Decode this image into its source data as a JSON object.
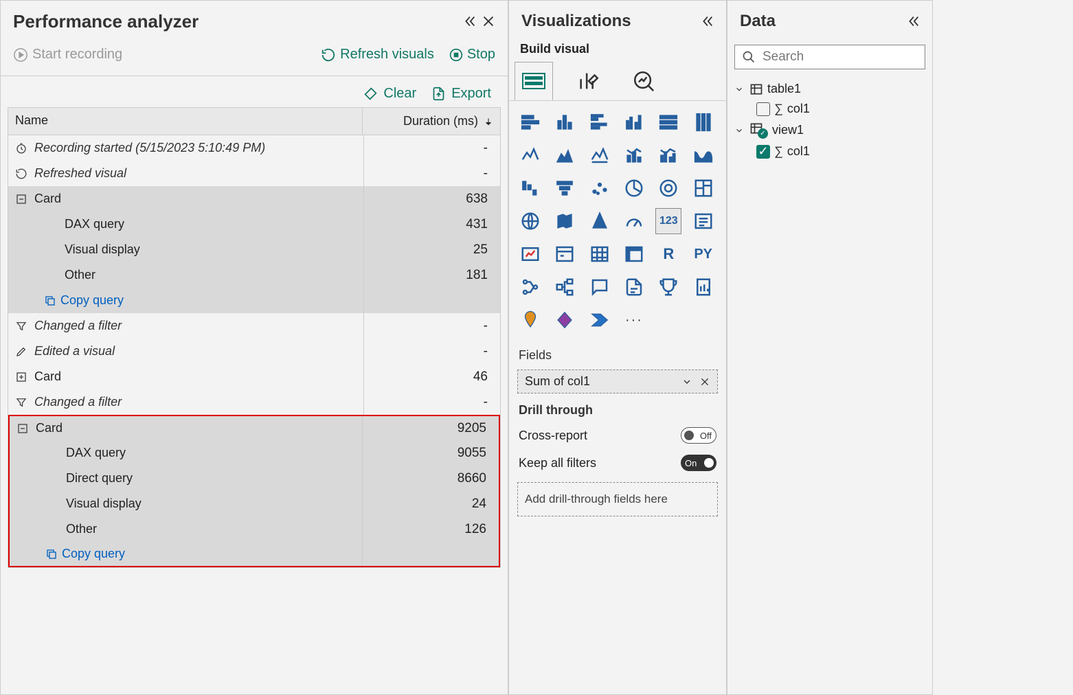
{
  "perf": {
    "title": "Performance analyzer",
    "start": "Start recording",
    "refresh": "Refresh visuals",
    "stop": "Stop",
    "clear": "Clear",
    "export": "Export",
    "col_name": "Name",
    "col_dur": "Duration (ms)",
    "copy_query": "Copy query",
    "rows": [
      {
        "icon": "clock",
        "label": "Recording started (5/15/2023 5:10:49 PM)",
        "dur": "-",
        "style": "italic"
      },
      {
        "icon": "refresh",
        "label": "Refreshed visual",
        "dur": "-",
        "style": "italic"
      },
      {
        "icon": "minus",
        "label": "Card",
        "dur": "638",
        "style": "sel"
      },
      {
        "icon": "",
        "label": "DAX query",
        "dur": "431",
        "style": "sel indent"
      },
      {
        "icon": "",
        "label": "Visual display",
        "dur": "25",
        "style": "sel indent"
      },
      {
        "icon": "",
        "label": "Other",
        "dur": "181",
        "style": "sel indent"
      },
      {
        "icon": "copy",
        "label": "Copy query",
        "dur": "",
        "style": "sel copy"
      },
      {
        "icon": "filter",
        "label": "Changed a filter",
        "dur": "-",
        "style": "italic"
      },
      {
        "icon": "pencil",
        "label": "Edited a visual",
        "dur": "-",
        "style": "italic"
      },
      {
        "icon": "plus",
        "label": "Card",
        "dur": "46",
        "style": ""
      },
      {
        "icon": "filter",
        "label": "Changed a filter",
        "dur": "-",
        "style": "italic"
      },
      {
        "icon": "minus",
        "label": "Card",
        "dur": "9205",
        "style": "sel hl hl-top"
      },
      {
        "icon": "",
        "label": "DAX query",
        "dur": "9055",
        "style": "sel hl indent"
      },
      {
        "icon": "",
        "label": "Direct query",
        "dur": "8660",
        "style": "sel hl indent"
      },
      {
        "icon": "",
        "label": "Visual display",
        "dur": "24",
        "style": "sel hl indent"
      },
      {
        "icon": "",
        "label": "Other",
        "dur": "126",
        "style": "sel hl indent"
      },
      {
        "icon": "copy",
        "label": "Copy query",
        "dur": "",
        "style": "sel hl hl-bot copy"
      }
    ]
  },
  "viz": {
    "title": "Visualizations",
    "build": "Build visual",
    "fields": "Fields",
    "field_value": "Sum of col1",
    "drill": "Drill through",
    "cross": "Cross-report",
    "cross_state": "Off",
    "keep": "Keep all filters",
    "keep_state": "On",
    "drop": "Add drill-through fields here"
  },
  "data": {
    "title": "Data",
    "search": "Search",
    "t1": "table1",
    "t1c1": "col1",
    "v1": "view1",
    "v1c1": "col1"
  }
}
